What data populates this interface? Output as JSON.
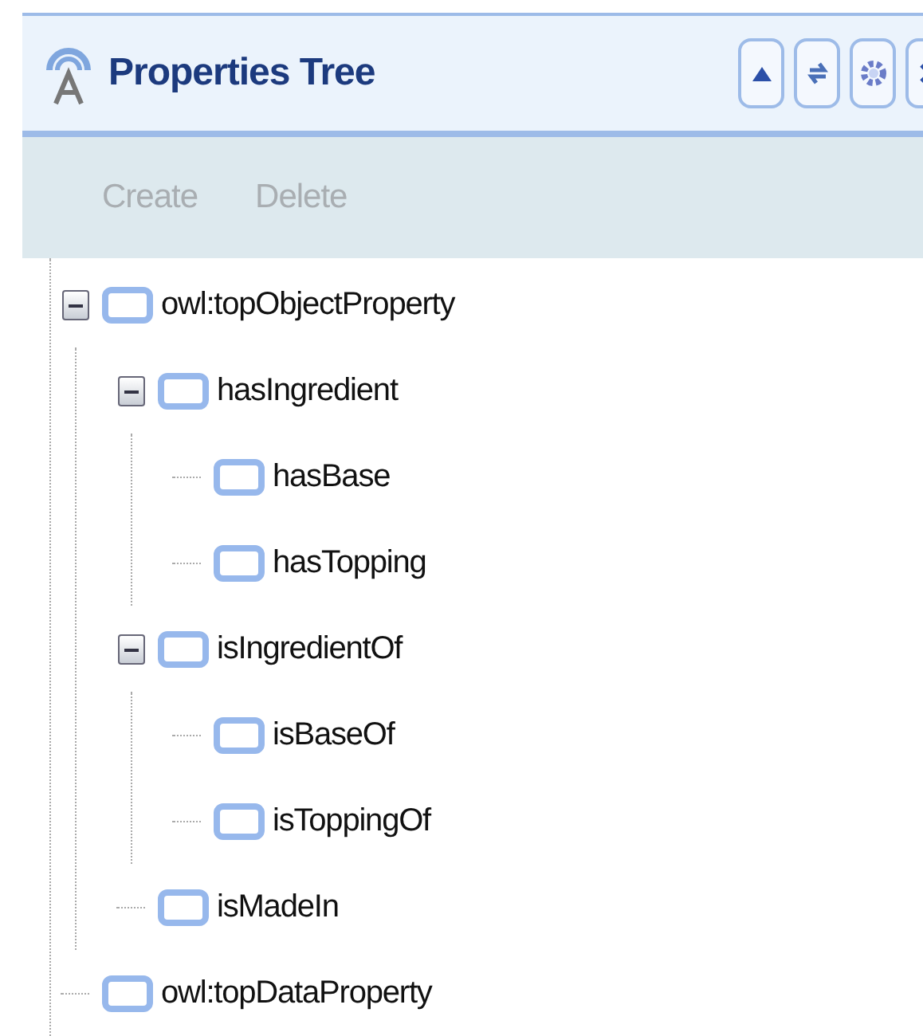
{
  "panel": {
    "title": "Properties Tree"
  },
  "toolbar": [
    {
      "label": "Create",
      "disabled": true
    },
    {
      "label": "Delete",
      "disabled": true
    }
  ],
  "tree": [
    {
      "label": "owl:topObjectProperty",
      "expanded": true,
      "children": [
        {
          "label": "hasIngredient",
          "expanded": true,
          "children": [
            {
              "label": "hasBase"
            },
            {
              "label": "hasTopping"
            }
          ]
        },
        {
          "label": "isIngredientOf",
          "expanded": true,
          "children": [
            {
              "label": "isBaseOf"
            },
            {
              "label": "isToppingOf"
            }
          ]
        },
        {
          "label": "isMadeIn"
        }
      ]
    },
    {
      "label": "owl:topDataProperty"
    }
  ]
}
